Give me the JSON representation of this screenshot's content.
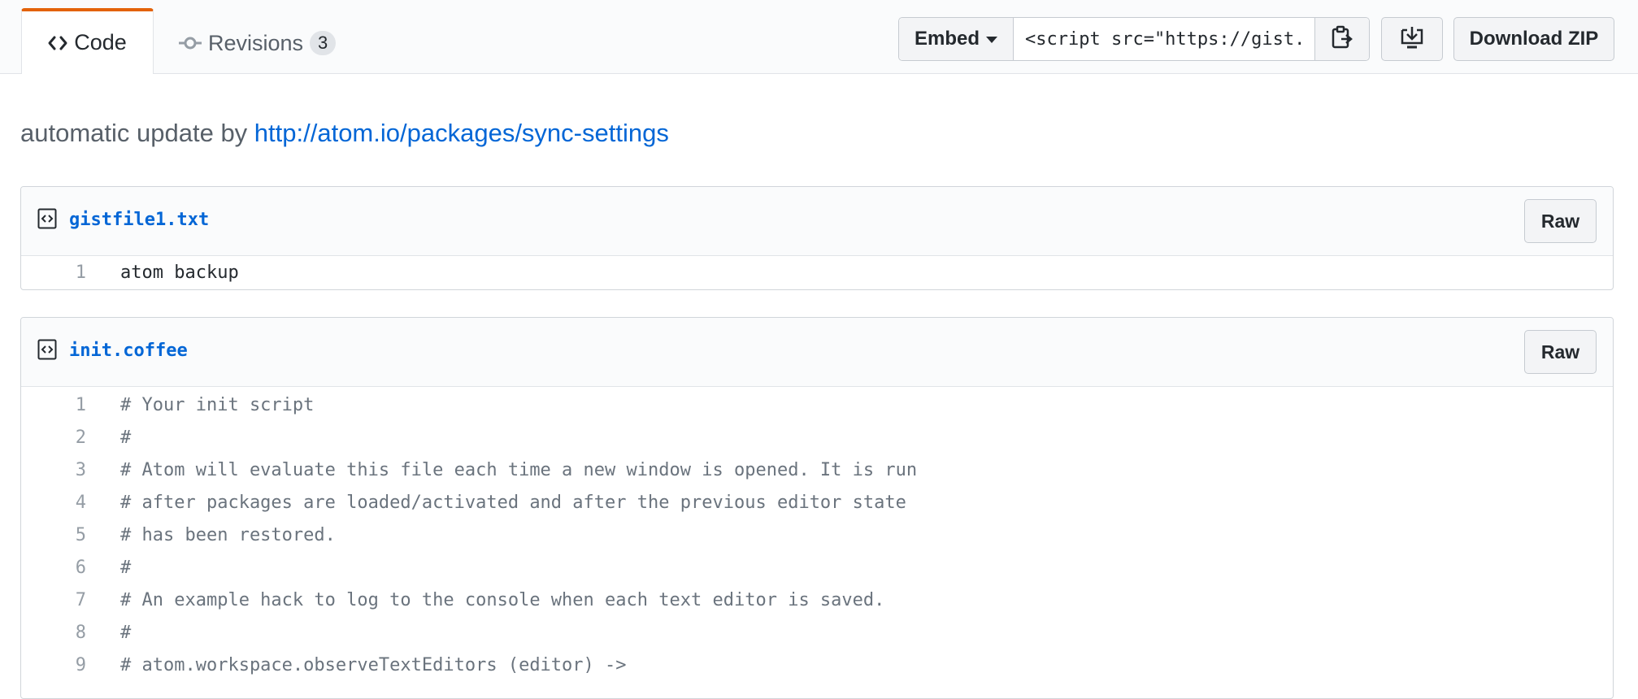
{
  "tabs": {
    "code_label": "Code",
    "revisions_label": "Revisions",
    "revisions_count": "3"
  },
  "toolbar": {
    "embed_label": "Embed",
    "embed_value": "<script src=\"https://gist.",
    "download_zip_label": "Download ZIP"
  },
  "description": {
    "prefix": "automatic update by ",
    "link_text": "http://atom.io/packages/sync-settings"
  },
  "files": [
    {
      "name": "gistfile1.txt",
      "raw_label": "Raw",
      "lines": [
        {
          "num": "1",
          "text": "atom backup"
        }
      ]
    },
    {
      "name": "init.coffee",
      "raw_label": "Raw",
      "lines": [
        {
          "num": "1",
          "text": "# Your init script"
        },
        {
          "num": "2",
          "text": "#"
        },
        {
          "num": "3",
          "text": "# Atom will evaluate this file each time a new window is opened. It is run"
        },
        {
          "num": "4",
          "text": "# after packages are loaded/activated and after the previous editor state"
        },
        {
          "num": "5",
          "text": "# has been restored."
        },
        {
          "num": "6",
          "text": "#"
        },
        {
          "num": "7",
          "text": "# An example hack to log to the console when each text editor is saved."
        },
        {
          "num": "8",
          "text": "#"
        },
        {
          "num": "9",
          "text": "# atom.workspace.observeTextEditors (editor) ->"
        }
      ]
    }
  ],
  "colors": {
    "accent_tab": "#e36209",
    "link": "#0366d6"
  },
  "icons": [
    "code-icon",
    "git-commit-icon",
    "caret-down-icon",
    "clipboard-icon",
    "desktop-download-icon",
    "file-code-icon"
  ]
}
